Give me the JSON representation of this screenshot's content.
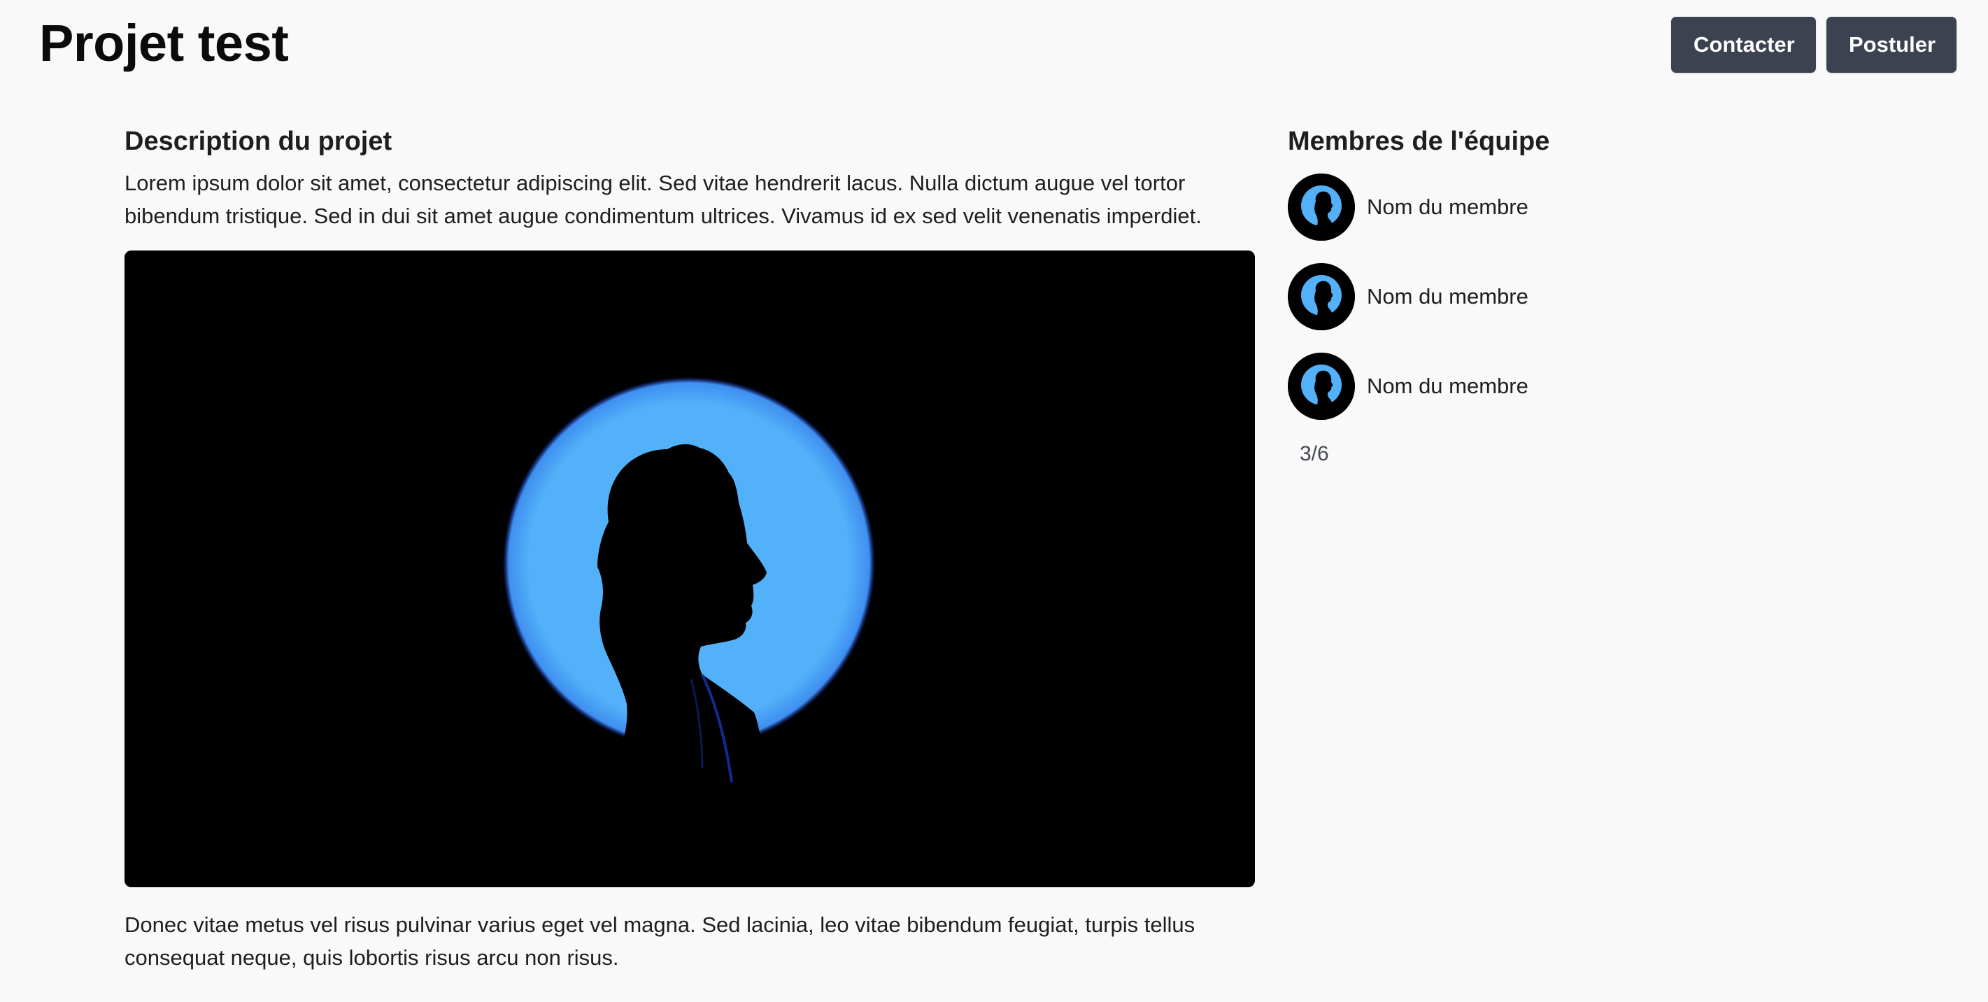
{
  "header": {
    "title": "Projet test",
    "contact_label": "Contacter",
    "apply_label": "Postuler"
  },
  "description": {
    "heading": "Description du projet",
    "intro": "Lorem ipsum dolor sit amet, consectetur adipiscing elit. Sed vitae hendrerit lacus. Nulla dictum augue vel tortor bibendum tristique. Sed in dui sit amet augue condimentum ultrices. Vivamus id ex sed velit venenatis imperdiet.",
    "image_icon": "silhouette-profile-blue-circle",
    "outro": "Donec vitae metus vel risus pulvinar varius eget vel magna. Sed lacinia, leo vitae bibendum feugiat, turpis tellus consequat neque, quis lobortis risus arcu non risus."
  },
  "team": {
    "heading": "Membres de l'équipe",
    "members": [
      {
        "name": "Nom du membre",
        "avatar_icon": "silhouette-avatar"
      },
      {
        "name": "Nom du membre",
        "avatar_icon": "silhouette-avatar"
      },
      {
        "name": "Nom du membre",
        "avatar_icon": "silhouette-avatar"
      }
    ],
    "count": "3/6"
  },
  "colors": {
    "background": "#f9f9f9",
    "button": "#3c4250",
    "button_text": "#ffffff",
    "accent_blue": "#52b1f8",
    "text": "#1e1e1e"
  }
}
